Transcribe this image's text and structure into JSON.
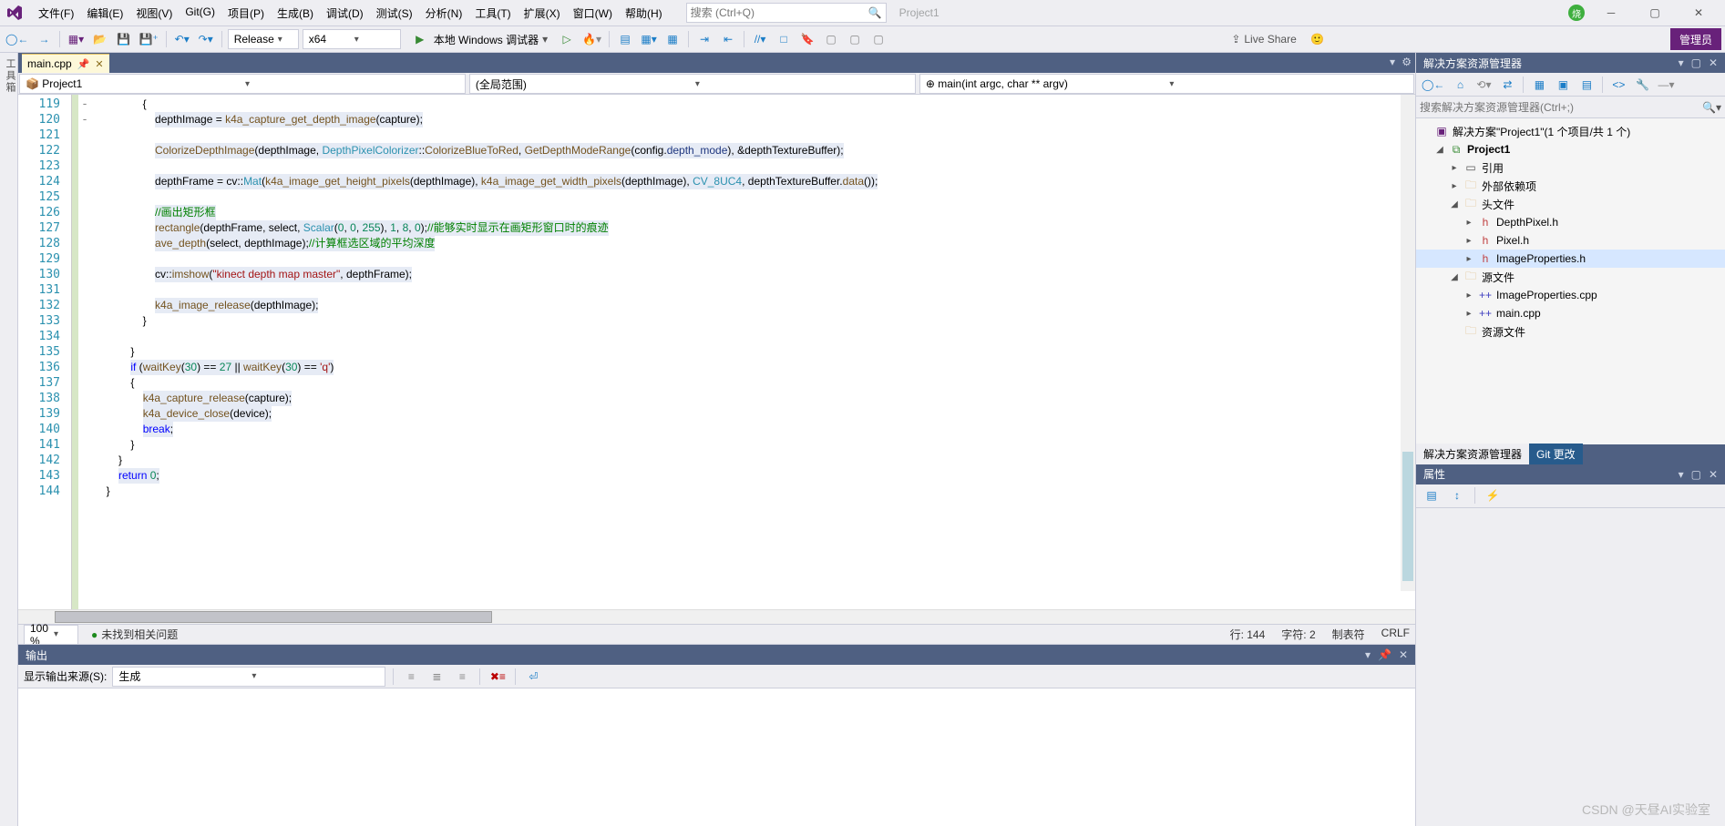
{
  "menu": [
    "文件(F)",
    "编辑(E)",
    "视图(V)",
    "Git(G)",
    "项目(P)",
    "生成(B)",
    "调试(D)",
    "测试(S)",
    "分析(N)",
    "工具(T)",
    "扩展(X)",
    "窗口(W)",
    "帮助(H)"
  ],
  "search_placeholder": "搜索 (Ctrl+Q)",
  "project_label": "Project1",
  "avatar": "烧",
  "toolbar": {
    "config": "Release",
    "platform": "x64",
    "debugger": "本地 Windows 调试器",
    "live_share": "Live Share",
    "admin": "管理员"
  },
  "left_rail": "工具箱",
  "tab": {
    "name": "main.cpp"
  },
  "scope": {
    "project": "Project1",
    "middle": "(全局范围)",
    "right": "main(int argc, char ** argv)"
  },
  "line_start": 119,
  "line_end": 144,
  "fold_marks": {
    "120": "-",
    "136": "-"
  },
  "code_lines": [
    {
      "c": "                 {"
    },
    {
      "c": "                     ",
      "hl": [
        {
          "t": "depthImage = ",
          "k": ""
        },
        {
          "t": "k4a_capture_get_depth_image",
          "k": "fn"
        },
        {
          "t": "(capture);",
          "k": ""
        }
      ]
    },
    {
      "c": ""
    },
    {
      "c": "                     ",
      "hl": [
        {
          "t": "ColorizeDepthImage",
          "k": "fn"
        },
        {
          "t": "(depthImage, ",
          "k": ""
        },
        {
          "t": "DepthPixelColorizer",
          "k": "cls"
        },
        {
          "t": "::",
          "k": ""
        },
        {
          "t": "ColorizeBlueToRed",
          "k": "fn"
        },
        {
          "t": ", ",
          "k": ""
        },
        {
          "t": "GetDepthModeRange",
          "k": "fn"
        },
        {
          "t": "(config.",
          "k": ""
        },
        {
          "t": "depth_mode",
          "k": "var"
        },
        {
          "t": "), &depthTextureBuffer);",
          "k": ""
        }
      ]
    },
    {
      "c": ""
    },
    {
      "c": "                     ",
      "hl": [
        {
          "t": "depthFrame = cv::",
          "k": ""
        },
        {
          "t": "Mat",
          "k": "cls"
        },
        {
          "t": "(",
          "k": ""
        },
        {
          "t": "k4a_image_get_height_pixels",
          "k": "fn"
        },
        {
          "t": "(depthImage), ",
          "k": ""
        },
        {
          "t": "k4a_image_get_width_pixels",
          "k": "fn"
        },
        {
          "t": "(depthImage), ",
          "k": ""
        },
        {
          "t": "CV_8UC4",
          "k": "type"
        },
        {
          "t": ", depthTextureBuffer.",
          "k": ""
        },
        {
          "t": "data",
          "k": "fn"
        },
        {
          "t": "());",
          "k": ""
        }
      ]
    },
    {
      "c": ""
    },
    {
      "c": "                     ",
      "hl": [
        {
          "t": "//画出矩形框",
          "k": "cmt"
        }
      ]
    },
    {
      "c": "                     ",
      "hl": [
        {
          "t": "rectangle",
          "k": "fn"
        },
        {
          "t": "(depthFrame, select, ",
          "k": ""
        },
        {
          "t": "Scalar",
          "k": "cls"
        },
        {
          "t": "(",
          "k": ""
        },
        {
          "t": "0",
          "k": "num"
        },
        {
          "t": ", ",
          "k": ""
        },
        {
          "t": "0",
          "k": "num"
        },
        {
          "t": ", ",
          "k": ""
        },
        {
          "t": "255",
          "k": "num"
        },
        {
          "t": "), ",
          "k": ""
        },
        {
          "t": "1",
          "k": "num"
        },
        {
          "t": ", ",
          "k": ""
        },
        {
          "t": "8",
          "k": "num"
        },
        {
          "t": ", ",
          "k": ""
        },
        {
          "t": "0",
          "k": "num"
        },
        {
          "t": ");",
          "k": ""
        },
        {
          "t": "//能够实时显示在画矩形窗口时的痕迹",
          "k": "cmt"
        }
      ]
    },
    {
      "c": "                     ",
      "hl": [
        {
          "t": "ave_depth",
          "k": "fn"
        },
        {
          "t": "(select, depthImage);",
          "k": ""
        },
        {
          "t": "//计算框选区域的平均深度",
          "k": "cmt"
        }
      ]
    },
    {
      "c": ""
    },
    {
      "c": "                     ",
      "hl": [
        {
          "t": "cv::",
          "k": ""
        },
        {
          "t": "imshow",
          "k": "fn"
        },
        {
          "t": "(",
          "k": ""
        },
        {
          "t": "\"kinect depth map master\"",
          "k": "str"
        },
        {
          "t": ", depthFrame);",
          "k": ""
        }
      ]
    },
    {
      "c": ""
    },
    {
      "c": "                     ",
      "hl": [
        {
          "t": "k4a_image_release",
          "k": "fn"
        },
        {
          "t": "(depthImage);",
          "k": ""
        }
      ]
    },
    {
      "c": "                 }"
    },
    {
      "c": ""
    },
    {
      "c": "             }"
    },
    {
      "c": "             ",
      "hl": [
        {
          "t": "if",
          "k": "kw"
        },
        {
          "t": " (",
          "k": ""
        },
        {
          "t": "waitKey",
          "k": "fn"
        },
        {
          "t": "(",
          "k": ""
        },
        {
          "t": "30",
          "k": "num"
        },
        {
          "t": ") == ",
          "k": ""
        },
        {
          "t": "27",
          "k": "num"
        },
        {
          "t": " || ",
          "k": ""
        },
        {
          "t": "waitKey",
          "k": "fn"
        },
        {
          "t": "(",
          "k": ""
        },
        {
          "t": "30",
          "k": "num"
        },
        {
          "t": ") == ",
          "k": ""
        },
        {
          "t": "'q'",
          "k": "str"
        },
        {
          "t": ")",
          "k": ""
        }
      ]
    },
    {
      "c": "             {"
    },
    {
      "c": "                 ",
      "hl": [
        {
          "t": "k4a_capture_release",
          "k": "fn"
        },
        {
          "t": "(capture);",
          "k": ""
        }
      ]
    },
    {
      "c": "                 ",
      "hl": [
        {
          "t": "k4a_device_close",
          "k": "fn"
        },
        {
          "t": "(device);",
          "k": ""
        }
      ]
    },
    {
      "c": "                 ",
      "hl": [
        {
          "t": "break",
          "k": "kw"
        },
        {
          "t": ";",
          "k": ""
        }
      ]
    },
    {
      "c": "             }"
    },
    {
      "c": "         }"
    },
    {
      "c": "         ",
      "hl": [
        {
          "t": "return",
          "k": "kw"
        },
        {
          "t": " ",
          "k": ""
        },
        {
          "t": "0",
          "k": "num"
        },
        {
          "t": ";",
          "k": ""
        }
      ]
    },
    {
      "c": "     }"
    }
  ],
  "status": {
    "zoom": "100 %",
    "issues": "未找到相关问题",
    "line": "行: 144",
    "col": "字符: 2",
    "tabs": "制表符",
    "eol": "CRLF"
  },
  "output": {
    "title": "输出",
    "src_label": "显示输出来源(S):",
    "source": "生成"
  },
  "se": {
    "title": "解决方案资源管理器",
    "search_placeholder": "搜索解决方案资源管理器(Ctrl+;)",
    "root": "解决方案\"Project1\"(1 个项目/共 1 个)",
    "project": "Project1",
    "refs": "引用",
    "ext_deps": "外部依赖项",
    "headers": "头文件",
    "header_items": [
      "DepthPixel.h",
      "Pixel.h",
      "ImageProperties.h"
    ],
    "sources": "源文件",
    "source_items": [
      "ImageProperties.cpp",
      "main.cpp"
    ],
    "resources": "资源文件"
  },
  "se_tabs": {
    "active": "解决方案资源管理器",
    "git": "Git 更改"
  },
  "props": {
    "title": "属性"
  },
  "watermark": "CSDN @天昼AI实验室"
}
